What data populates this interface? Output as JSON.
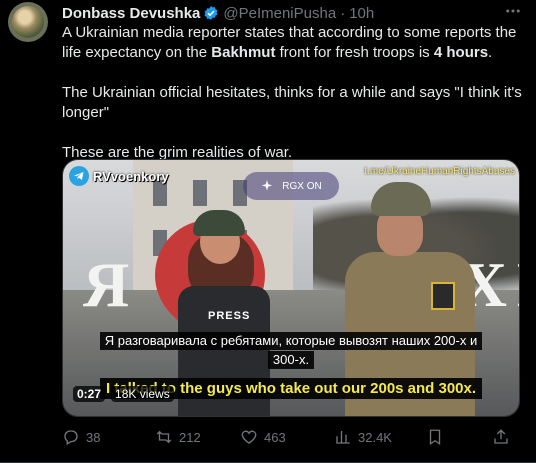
{
  "tweet": {
    "author_name": "Donbass Devushka",
    "handle": "@PeImeniPusha",
    "separator": "·",
    "time": "10h",
    "paragraph1": {
      "part1": "A Ukrainian media reporter states that according to some reports the life expectancy on the ",
      "bold1": "Bakhmut",
      "part2": " front for fresh troops is ",
      "bold2": "4 hours",
      "part3": "."
    },
    "paragraph2": "The Ukrainian official hesitates, thinks for a while and says \"I think it's longer\"",
    "paragraph3": "These are the grim realities of war."
  },
  "media": {
    "channel_name": "RVvoenkory",
    "watermark": "t.me/UkraineHumanRightsAbuses",
    "rgx_label": "RGX ON",
    "press_label": "PRESS",
    "sign_left": "Я",
    "sign_right": "БАХМ",
    "subtitle_ru_line1": "Я разговаривала с ребятами, которые вывозят наших 200-х и",
    "subtitle_ru_line2": "300-х.",
    "subtitle_en": "I talked to the guys who take out our 200s and 300x.",
    "elapsed": "0:27",
    "views": "18K views"
  },
  "actions": {
    "replies": "38",
    "retweets": "212",
    "likes": "463",
    "views": "32.4K"
  },
  "colors": {
    "background": "#000000",
    "text": "#e7e9ea",
    "secondary": "#71767b",
    "verified": "#1d9bf0",
    "subtitle_en": "#f4ea4a"
  },
  "icons": [
    "verified-badge-icon",
    "more-icon",
    "telegram-icon",
    "sparkle-icon",
    "reply-icon",
    "retweet-icon",
    "like-icon",
    "views-icon",
    "bookmark-icon",
    "share-icon"
  ]
}
